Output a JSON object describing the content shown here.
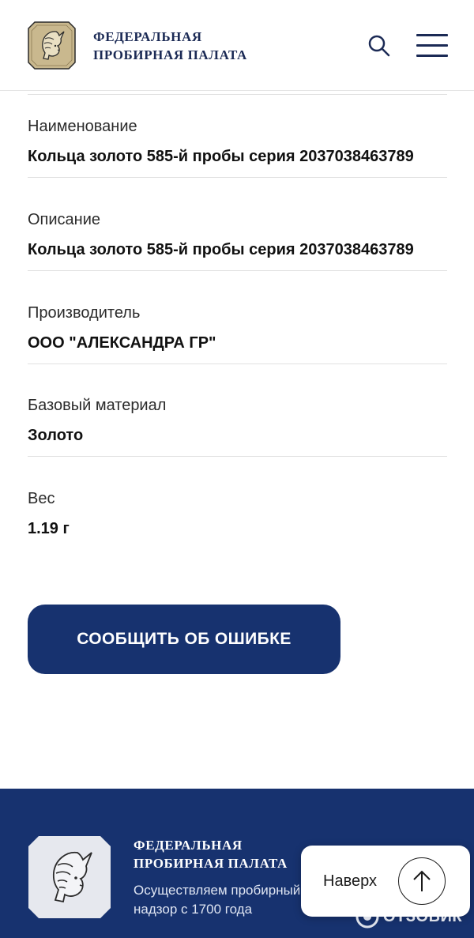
{
  "header": {
    "brand_line1": "ФЕДЕРАЛЬНАЯ",
    "brand_line2": "ПРОБИРНАЯ ПАЛАТА",
    "logo_icon": "assay-chamber-emblem-icon",
    "search_icon": "search-icon",
    "menu_icon": "hamburger-menu-icon"
  },
  "fields": [
    {
      "label": "Наименование",
      "value": "Кольца золото 585-й пробы серия 2037038463789"
    },
    {
      "label": "Описание",
      "value": "Кольца золото 585-й пробы серия 2037038463789"
    },
    {
      "label": "Производитель",
      "value": "ООО \"АЛЕКСАНДРА ГР\""
    },
    {
      "label": "Базовый материал",
      "value": "Золото"
    },
    {
      "label": "Вес",
      "value": "1.19 г"
    }
  ],
  "report_button": {
    "label": "СООБЩИТЬ ОБ ОШИБКЕ"
  },
  "footer": {
    "brand_line1": "ФЕДЕРАЛЬНАЯ",
    "brand_line2": "ПРОБИРНАЯ ПАЛАТА",
    "desc_line1": "Осуществляем пробирный",
    "desc_line2": "надзор с 1700 года"
  },
  "scroll_top": {
    "label": "Наверх",
    "icon": "arrow-up-icon"
  },
  "watermark": {
    "text": "ОТЗОВИК"
  },
  "colors": {
    "primary": "#17326f",
    "text": "#111111",
    "divider": "#e0e0e0"
  }
}
